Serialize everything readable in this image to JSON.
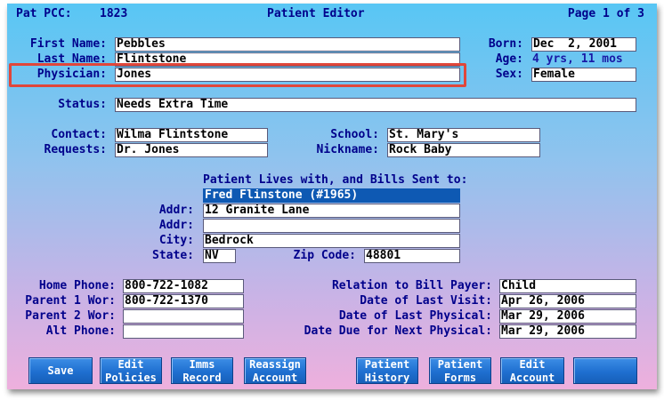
{
  "header": {
    "pcc_label": "Pat PCC:",
    "pcc_value": "1823",
    "title": "Patient Editor",
    "page": "Page 1 of 3"
  },
  "patient": {
    "first_name_label": "First Name:",
    "first_name": "Pebbles",
    "last_name_label": "Last Name:",
    "last_name": "Flintstone",
    "physician_label": "Physician:",
    "physician": "Jones",
    "born_label": "Born:",
    "born": "Dec  2, 2001",
    "age_label": "Age:",
    "age": "4 yrs, 11 mos",
    "sex_label": "Sex:",
    "sex": "Female",
    "status_label": "Status:",
    "status": "Needs Extra Time",
    "contact_label": "Contact:",
    "contact": "Wilma Flintstone",
    "requests_label": "Requests:",
    "requests": "Dr. Jones",
    "school_label": "School:",
    "school": "St. Mary's",
    "nickname_label": "Nickname:",
    "nickname": "Rock Baby"
  },
  "billing": {
    "heading": "Patient Lives with, and Bills Sent to:",
    "billpayer": "Fred Flinstone (#1965)",
    "addr_label": "Addr:",
    "addr1": "12 Granite Lane",
    "addr2": "",
    "city_label": "City:",
    "city": "Bedrock",
    "state_label": "State:",
    "state": "NV",
    "zip_label": "Zip Code:",
    "zip": "48801"
  },
  "contact_info": {
    "home_phone_label": "Home Phone:",
    "home_phone": "800-722-1082",
    "parent1_label": "Parent 1 Wor:",
    "parent1": "800-722-1370",
    "parent2_label": "Parent 2 Wor:",
    "parent2": "",
    "alt_phone_label": "Alt Phone:",
    "alt_phone": "",
    "relation_label": "Relation to Bill Payer:",
    "relation": "Child",
    "last_visit_label": "Date of Last Visit:",
    "last_visit": "Apr 26, 2006",
    "last_physical_label": "Date of Last Physical:",
    "last_physical": "Mar 29, 2006",
    "next_physical_label": "Date Due for Next Physical:",
    "next_physical": "Mar 29, 2006"
  },
  "buttons": {
    "save": "Save",
    "edit_policies_1": "Edit",
    "edit_policies_2": "Policies",
    "imms_1": "Imms",
    "imms_2": "Record",
    "reassign_1": "Reassign",
    "reassign_2": "Account",
    "history_1": "Patient",
    "history_2": "History",
    "forms_1": "Patient",
    "forms_2": "Forms",
    "edit_account_1": "Edit",
    "edit_account_2": "Account"
  },
  "colors": {
    "label": "#00008b",
    "field_bg": "#ffffff",
    "selected": "#0e59b3",
    "highlight": "#e0463a",
    "button": "#1f6fd0"
  }
}
